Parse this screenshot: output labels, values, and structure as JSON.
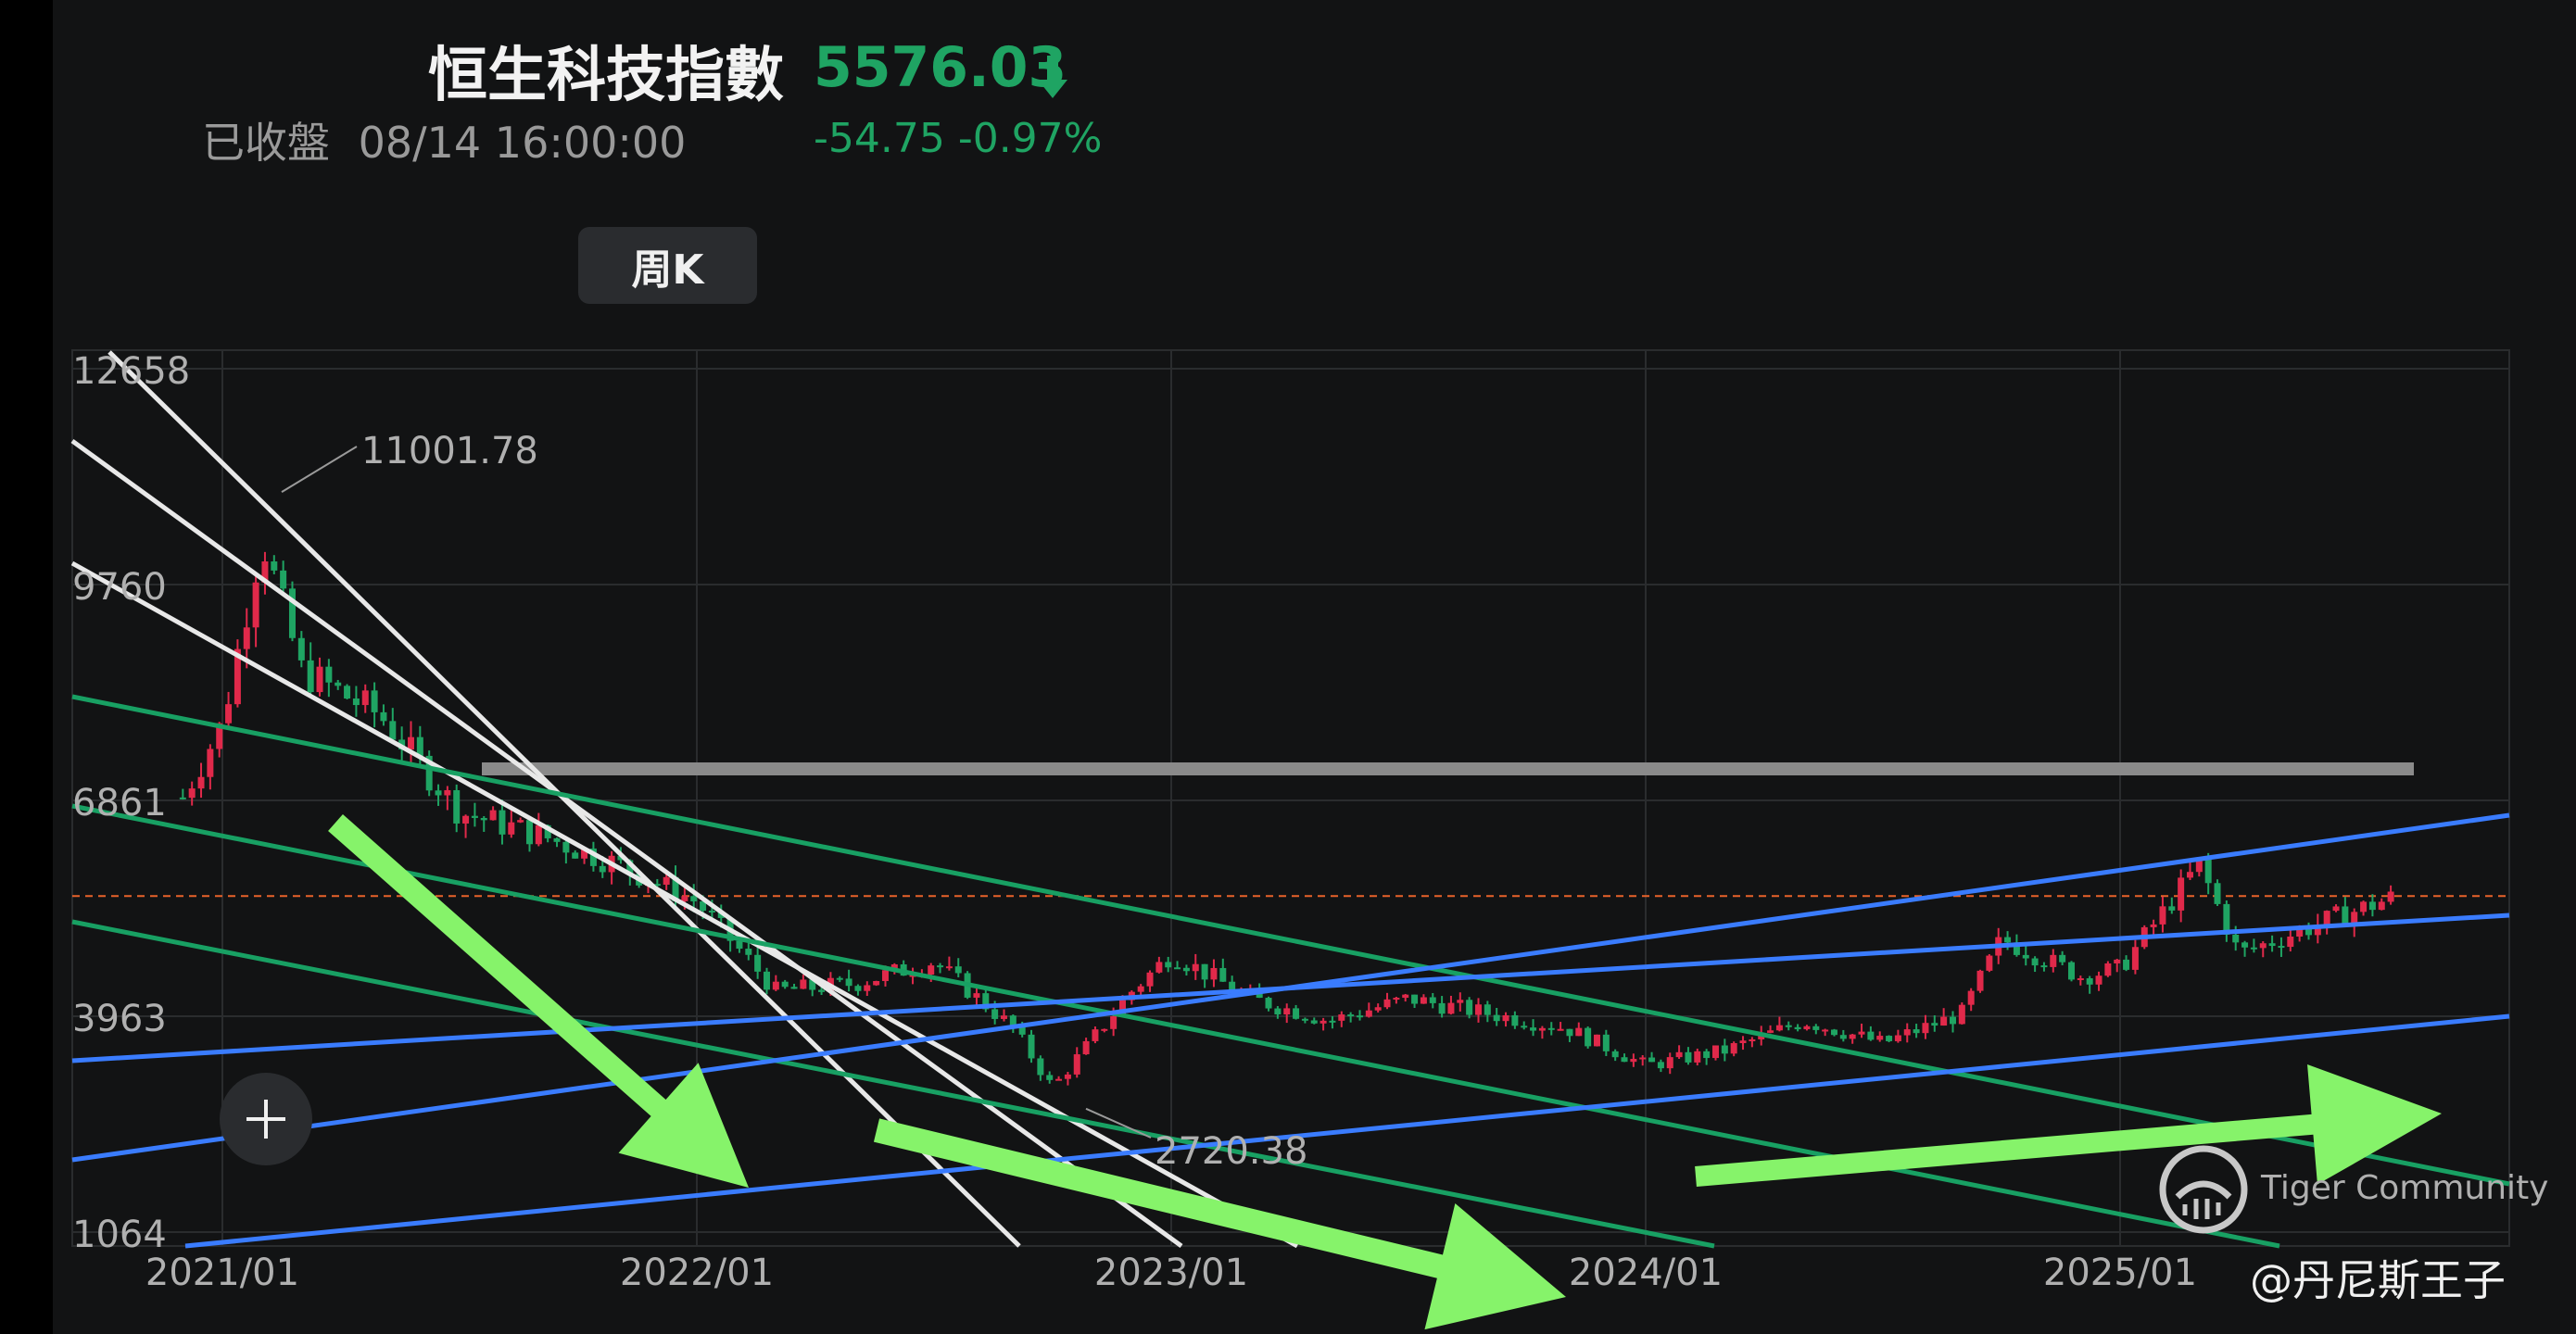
{
  "header": {
    "title": "恒生科技指數",
    "price": "5576.03",
    "status": "已收盤",
    "datetime": "08/14 16:00:00",
    "change": "-54.75 -0.97%",
    "change_color": "#1fa463",
    "arrow_icon": "down-arrow-icon"
  },
  "tab": {
    "label": "周K"
  },
  "watermark": {
    "text": "Tiger Community",
    "icon": "tiger-logo-icon"
  },
  "author": "@丹尼斯王子",
  "colors": {
    "up": "#e0294a",
    "down": "#1fa463",
    "trend_up": "#3a7cff",
    "trend_down": "#18a063",
    "channel": "#e8e8e8",
    "resistance": "#8a8a8a",
    "annotation_arrow": "#86f36a",
    "current_line": "#e8632a"
  },
  "chart_data": {
    "type": "candlestick",
    "title": "恒生科技指數",
    "period": "周K",
    "ylim": [
      1064,
      12658
    ],
    "y_ticks": [
      12658,
      9760,
      6861,
      3963,
      1064
    ],
    "x_ticks": [
      "2021/01",
      "2022/01",
      "2023/01",
      "2024/01",
      "2025/01"
    ],
    "annotations": {
      "high": {
        "label": "11001.78",
        "value": 11001.78,
        "date": "2021/02"
      },
      "low": {
        "label": "2720.38",
        "value": 2720.38,
        "date": "2022/10"
      }
    },
    "last_price": 5576.03,
    "resistance_level": 6861,
    "series_close": [
      [
        "2020/12",
        6900
      ],
      [
        "2021/01",
        7900
      ],
      [
        "2021/02",
        10400
      ],
      [
        "2021/03",
        8600
      ],
      [
        "2021/05",
        8000
      ],
      [
        "2021/07",
        6700
      ],
      [
        "2021/09",
        6400
      ],
      [
        "2021/11",
        6000
      ],
      [
        "2022/01",
        5500
      ],
      [
        "2022/03",
        4300
      ],
      [
        "2022/05",
        4400
      ],
      [
        "2022/07",
        4700
      ],
      [
        "2022/09",
        3800
      ],
      [
        "2022/10",
        3000
      ],
      [
        "2022/12",
        4300
      ],
      [
        "2023/01",
        4800
      ],
      [
        "2023/03",
        4200
      ],
      [
        "2023/05",
        3900
      ],
      [
        "2023/07",
        4200
      ],
      [
        "2023/09",
        4000
      ],
      [
        "2023/11",
        3800
      ],
      [
        "2024/01",
        3300
      ],
      [
        "2024/03",
        3500
      ],
      [
        "2024/05",
        3900
      ],
      [
        "2024/07",
        3600
      ],
      [
        "2024/09",
        4000
      ],
      [
        "2024/10",
        5000
      ],
      [
        "2024/12",
        4500
      ],
      [
        "2025/01",
        4600
      ],
      [
        "2025/03",
        6000
      ],
      [
        "2025/04",
        4800
      ],
      [
        "2025/06",
        5200
      ],
      [
        "2025/08",
        5576
      ]
    ]
  }
}
